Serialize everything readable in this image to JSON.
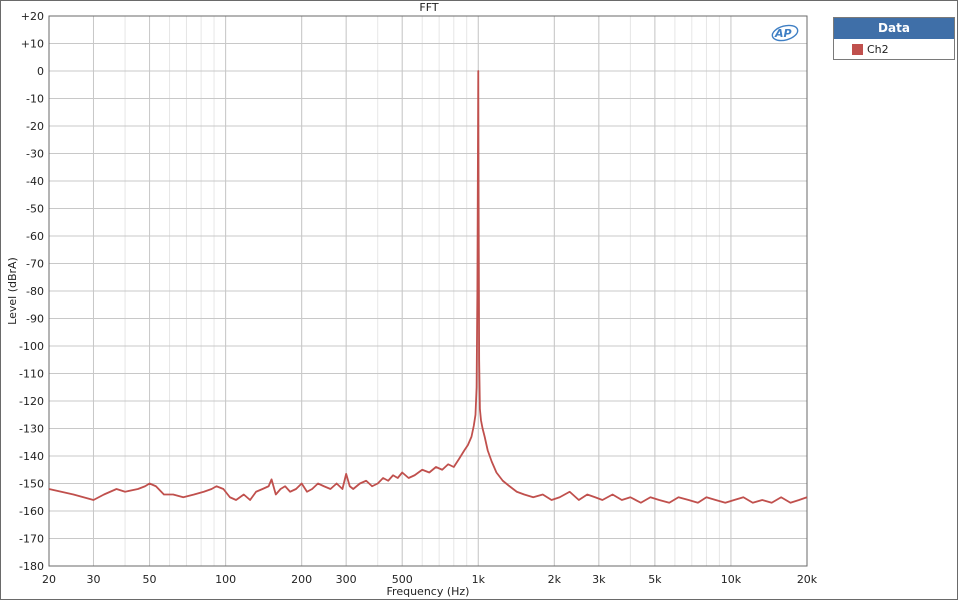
{
  "chart_data": {
    "type": "line",
    "title": "FFT",
    "xlabel": "Frequency (Hz)",
    "ylabel": "Level (dBrA)",
    "xscale": "log",
    "xlim": [
      20,
      20000
    ],
    "ylim": [
      -180,
      20
    ],
    "grid": true,
    "legend_placement": "right",
    "x_ticks": [
      {
        "value": 20,
        "label": "20"
      },
      {
        "value": 30,
        "label": "30"
      },
      {
        "value": 50,
        "label": "50"
      },
      {
        "value": 100,
        "label": "100"
      },
      {
        "value": 200,
        "label": "200"
      },
      {
        "value": 300,
        "label": "300"
      },
      {
        "value": 500,
        "label": "500"
      },
      {
        "value": 1000,
        "label": "1k"
      },
      {
        "value": 2000,
        "label": "2k"
      },
      {
        "value": 3000,
        "label": "3k"
      },
      {
        "value": 5000,
        "label": "5k"
      },
      {
        "value": 10000,
        "label": "10k"
      },
      {
        "value": 20000,
        "label": "20k"
      }
    ],
    "y_ticks": [
      {
        "value": 20,
        "label": "+20"
      },
      {
        "value": 10,
        "label": "+10"
      },
      {
        "value": 0,
        "label": "0"
      },
      {
        "value": -10,
        "label": "-10"
      },
      {
        "value": -20,
        "label": "-20"
      },
      {
        "value": -30,
        "label": "-30"
      },
      {
        "value": -40,
        "label": "-40"
      },
      {
        "value": -50,
        "label": "-50"
      },
      {
        "value": -60,
        "label": "-60"
      },
      {
        "value": -70,
        "label": "-70"
      },
      {
        "value": -80,
        "label": "-80"
      },
      {
        "value": -90,
        "label": "-90"
      },
      {
        "value": -100,
        "label": "-100"
      },
      {
        "value": -110,
        "label": "-110"
      },
      {
        "value": -120,
        "label": "-120"
      },
      {
        "value": -130,
        "label": "-130"
      },
      {
        "value": -140,
        "label": "-140"
      },
      {
        "value": -150,
        "label": "-150"
      },
      {
        "value": -160,
        "label": "-160"
      },
      {
        "value": -170,
        "label": "-170"
      },
      {
        "value": -180,
        "label": "-180"
      }
    ],
    "legend_title": "Data",
    "series": [
      {
        "name": "Ch2",
        "color": "#c0504d",
        "x": [
          20,
          25,
          30,
          33,
          37,
          40,
          45,
          48,
          50,
          53,
          57,
          62,
          68,
          75,
          82,
          88,
          92,
          98,
          104,
          110,
          118,
          125,
          132,
          140,
          148,
          152,
          158,
          165,
          172,
          180,
          190,
          200,
          210,
          220,
          232,
          245,
          260,
          275,
          290,
          300,
          310,
          320,
          340,
          360,
          380,
          400,
          420,
          440,
          460,
          480,
          500,
          530,
          560,
          600,
          640,
          680,
          720,
          760,
          800,
          840,
          880,
          910,
          940,
          960,
          975,
          985,
          992,
          997,
          1000,
          1003,
          1008,
          1015,
          1025,
          1040,
          1060,
          1090,
          1130,
          1180,
          1250,
          1330,
          1420,
          1520,
          1650,
          1800,
          1950,
          2100,
          2300,
          2500,
          2700,
          2900,
          3100,
          3400,
          3700,
          4000,
          4400,
          4800,
          5200,
          5700,
          6200,
          6800,
          7400,
          8000,
          8700,
          9500,
          10300,
          11200,
          12200,
          13300,
          14500,
          15800,
          17200,
          18600,
          20000
        ],
        "values": [
          -152,
          -154,
          -156,
          -154,
          -152,
          -153,
          -152,
          -151,
          -150,
          -151,
          -154,
          -154,
          -155,
          -154,
          -153,
          -152,
          -151,
          -152,
          -155,
          -156,
          -154,
          -156,
          -153,
          -152,
          -151,
          -148.5,
          -154,
          -152,
          -151,
          -153,
          -152,
          -150,
          -153,
          -152,
          -150,
          -151,
          -152,
          -150,
          -152,
          -146.5,
          -151,
          -152,
          -150,
          -149,
          -151,
          -150,
          -148,
          -149,
          -147,
          -148,
          -146,
          -148,
          -147,
          -145,
          -146,
          -144,
          -145,
          -143,
          -144,
          -141,
          -138,
          -136,
          -133,
          -129,
          -125,
          -115,
          -80,
          -30,
          0,
          -45,
          -105,
          -123,
          -127,
          -130,
          -133,
          -138,
          -142,
          -146,
          -149,
          -151,
          -153,
          -154,
          -155,
          -154,
          -156,
          -155,
          -153,
          -156,
          -154,
          -155,
          -156,
          -154,
          -156,
          -155,
          -157,
          -155,
          -156,
          -157,
          -155,
          -156,
          -157,
          -155,
          -156,
          -157,
          -156,
          -155,
          -157,
          -156,
          -157,
          -155,
          -157,
          -156,
          -155
        ]
      }
    ]
  }
}
